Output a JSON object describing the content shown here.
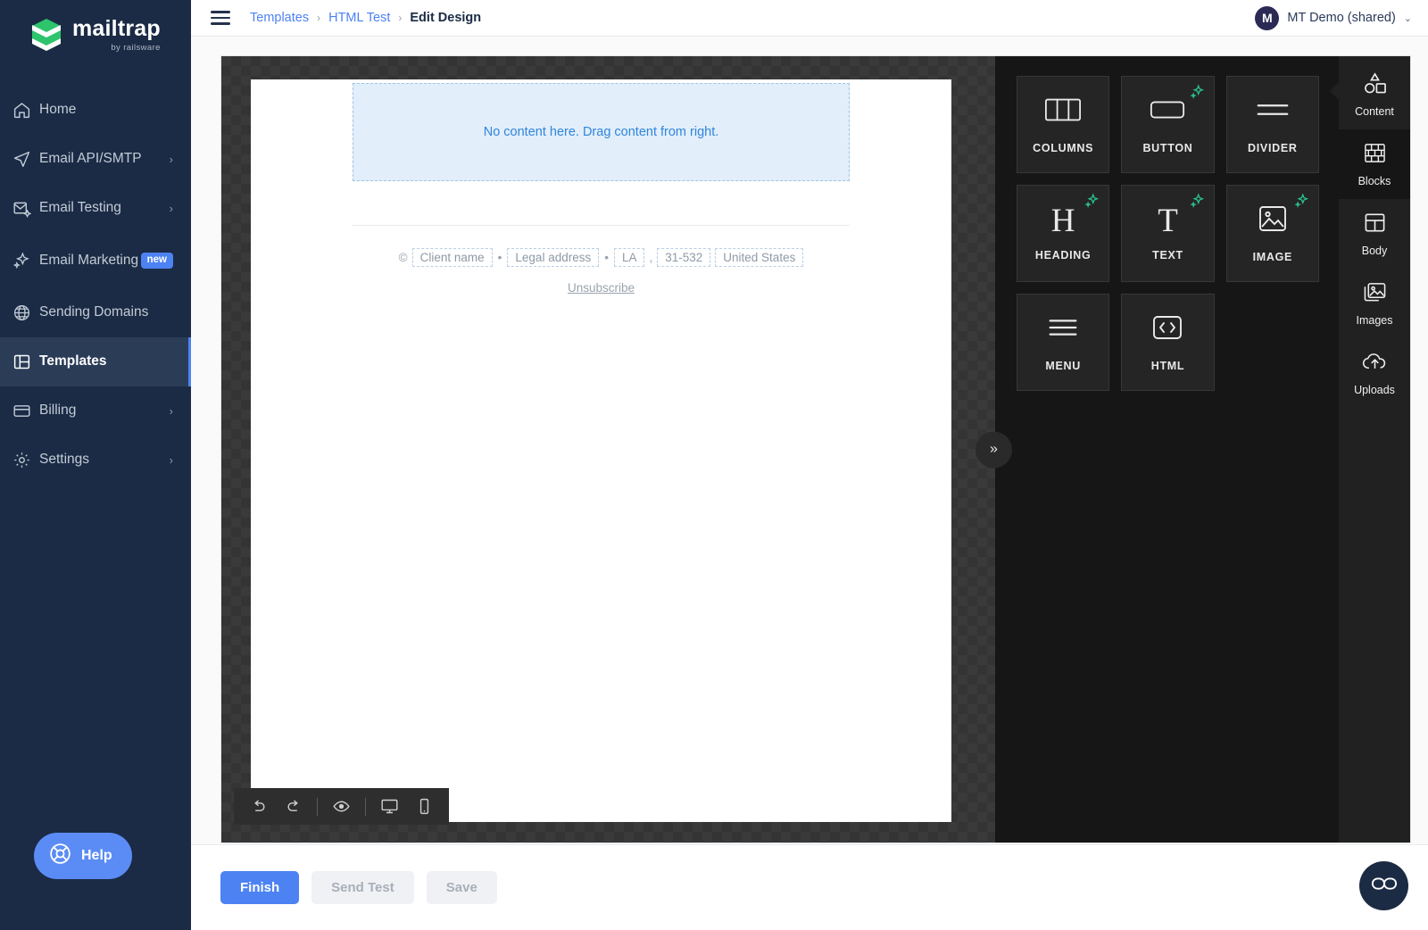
{
  "brand": {
    "name": "mailtrap",
    "tagline": "by railsware",
    "logo_icon": "mailtrap-m-logo"
  },
  "sidebar": {
    "items": [
      {
        "label": "Home",
        "icon": "home-icon",
        "chevron": "",
        "badge": "",
        "active": false
      },
      {
        "label": "Email API/SMTP",
        "icon": "send-icon",
        "chevron": "›",
        "badge": "",
        "active": false
      },
      {
        "label": "Email Testing",
        "icon": "inbox-check-icon",
        "chevron": "›",
        "badge": "",
        "active": false
      },
      {
        "label": "Email Marketing",
        "icon": "sparkle-icon",
        "chevron": "",
        "badge": "new",
        "active": false
      },
      {
        "label": "Sending Domains",
        "icon": "globe-icon",
        "chevron": "",
        "badge": "",
        "active": false
      },
      {
        "label": "Templates",
        "icon": "layout-icon",
        "chevron": "",
        "badge": "",
        "active": true
      },
      {
        "label": "Billing",
        "icon": "card-icon",
        "chevron": "›",
        "badge": "",
        "active": false
      },
      {
        "label": "Settings",
        "icon": "gear-icon",
        "chevron": "›",
        "badge": "",
        "active": false
      }
    ],
    "help": {
      "label": "Help",
      "icon": "life-ring-icon"
    }
  },
  "topbar": {
    "menu_icon": "hamburger-icon",
    "breadcrumbs": [
      {
        "label": "Templates",
        "current": false
      },
      {
        "label": "HTML Test",
        "current": false
      },
      {
        "label": "Edit Design",
        "current": true
      }
    ],
    "separator": "›",
    "account": {
      "initial": "M",
      "name": "MT Demo (shared)",
      "caret": "⌄"
    }
  },
  "canvas": {
    "drop_zone_text": "No content here. Drag content from right.",
    "footer": {
      "copyright": "©",
      "fields": [
        "Client name",
        "Legal address",
        "LA",
        "31-532",
        "United States"
      ],
      "separator_dot": "•",
      "comma": ",",
      "unsubscribe": "Unsubscribe"
    },
    "toolbar": [
      {
        "name": "undo-icon",
        "glyph": "↺"
      },
      {
        "name": "redo-icon",
        "glyph": "↻"
      },
      {
        "name": "preview-eye-icon",
        "glyph": "◉"
      },
      {
        "name": "desktop-view-icon",
        "glyph": "🖥"
      },
      {
        "name": "mobile-view-icon",
        "glyph": "▯"
      }
    ],
    "collapse_button": "»"
  },
  "blocks_panel": {
    "tiles": [
      {
        "label": "COLUMNS",
        "icon": "columns-icon",
        "ai": false
      },
      {
        "label": "BUTTON",
        "icon": "button-icon",
        "ai": true
      },
      {
        "label": "DIVIDER",
        "icon": "divider-icon",
        "ai": false
      },
      {
        "label": "HEADING",
        "icon": "heading-h-icon",
        "ai": true
      },
      {
        "label": "TEXT",
        "icon": "text-t-icon",
        "ai": true
      },
      {
        "label": "IMAGE",
        "icon": "image-icon",
        "ai": true
      },
      {
        "label": "MENU",
        "icon": "menu-lines-icon",
        "ai": false
      },
      {
        "label": "HTML",
        "icon": "code-brackets-icon",
        "ai": false
      }
    ]
  },
  "rail": {
    "items": [
      {
        "label": "Content",
        "icon": "shapes-icon",
        "active": false
      },
      {
        "label": "Blocks",
        "icon": "bricks-icon",
        "active": true
      },
      {
        "label": "Body",
        "icon": "body-layout-icon",
        "active": false
      },
      {
        "label": "Images",
        "icon": "images-stack-icon",
        "active": false
      },
      {
        "label": "Uploads",
        "icon": "cloud-upload-icon",
        "active": false
      }
    ]
  },
  "bottombar": {
    "buttons": [
      {
        "label": "Finish",
        "style": "primary"
      },
      {
        "label": "Send Test",
        "style": "disabled"
      },
      {
        "label": "Save",
        "style": "disabled"
      }
    ]
  },
  "widget": {
    "icon": "chat-widget-icon",
    "glyph": "ᯤ"
  },
  "colors": {
    "sidebar_bg": "#1b2b45",
    "accent_blue": "#4d82f3",
    "brand_green": "#2ec46c",
    "panel_dark": "#161616",
    "rail_dark": "#212121",
    "ai_green": "#2bbf8a"
  }
}
